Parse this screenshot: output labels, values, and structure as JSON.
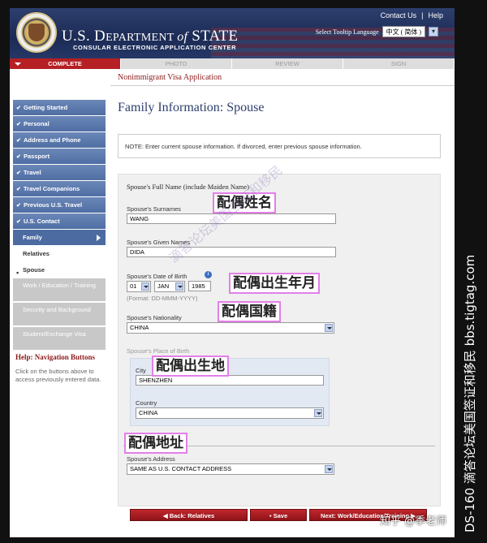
{
  "header": {
    "dept_prefix": "U.S. D",
    "dept_rest": "EPARTMENT ",
    "dept_of": "of",
    "dept_state": " STATE",
    "subtitle": "CONSULAR ELECTRONIC APPLICATION CENTER",
    "contact_us": "Contact Us",
    "help": "Help",
    "tooltip_label": "Select Tooltip Language",
    "language_value": "中文 ( 简体 )"
  },
  "progress": {
    "steps": [
      "COMPLETE",
      "PHOTO",
      "REVIEW",
      "SIGN"
    ]
  },
  "application_title": "Nonimmigrant Visa Application",
  "sidebar": {
    "items": [
      "Getting Started",
      "Personal",
      "Address and Phone",
      "Passport",
      "Travel",
      "Travel Companions",
      "Previous U.S. Travel",
      "U.S. Contact"
    ],
    "family": "Family",
    "relatives": "Relatives",
    "spouse": "Spouse",
    "disabled": [
      "Work / Education / Training",
      "Security and Background",
      "Student/Exchange Visa"
    ],
    "help_title": "Help: Navigation Buttons",
    "help_text": "Click on the buttons above to access previously entered data."
  },
  "main": {
    "page_title": "Family Information: Spouse",
    "note": "NOTE: Enter current spouse information. If divorced, enter previous spouse information.",
    "full_name_label": "Spouse's Full Name (include Maiden Name)",
    "surnames_label": "Spouse's Surnames",
    "surnames_value": "WANG",
    "given_names_label": "Spouse's Given Names",
    "given_names_value": "DIDA",
    "dob_label": "Spouse's Date of Birth",
    "dob_day": "01",
    "dob_month": "JAN",
    "dob_year": "1985",
    "dob_format": "(Format: DD-MMM-YYYY)",
    "nationality_label": "Spouse's Nationality",
    "nationality_value": "CHINA",
    "place_of_birth_label": "Spouse's Place of Birth",
    "city_label": "City",
    "city_value": "SHENZHEN",
    "country_label": "Country",
    "country_value": "CHINA",
    "address_label": "Spouse's Address",
    "address_value": "SAME AS U.S. CONTACT ADDRESS"
  },
  "annotations": {
    "name": "配偶姓名",
    "dob": "配偶出生年月",
    "nationality": "配偶国籍",
    "birthplace": "配偶出生地",
    "address": "配偶地址"
  },
  "buttons": {
    "back": "◀ Back: Relatives",
    "save": "Save",
    "next": "Next: Work/Education/Training ▶"
  },
  "watermarks": {
    "vertical": "DS-160 滴答论坛美国签证和移民 bbs.tigtag.com",
    "zhihu": "知乎 @季老师",
    "diagonal": "滴答论坛美国签证和移民"
  },
  "colors": {
    "header_navy": "#1c2b55",
    "accent_red": "#b52025",
    "sidebar_blue": "#4f6ea3",
    "annotation_border": "#e37fe8"
  }
}
